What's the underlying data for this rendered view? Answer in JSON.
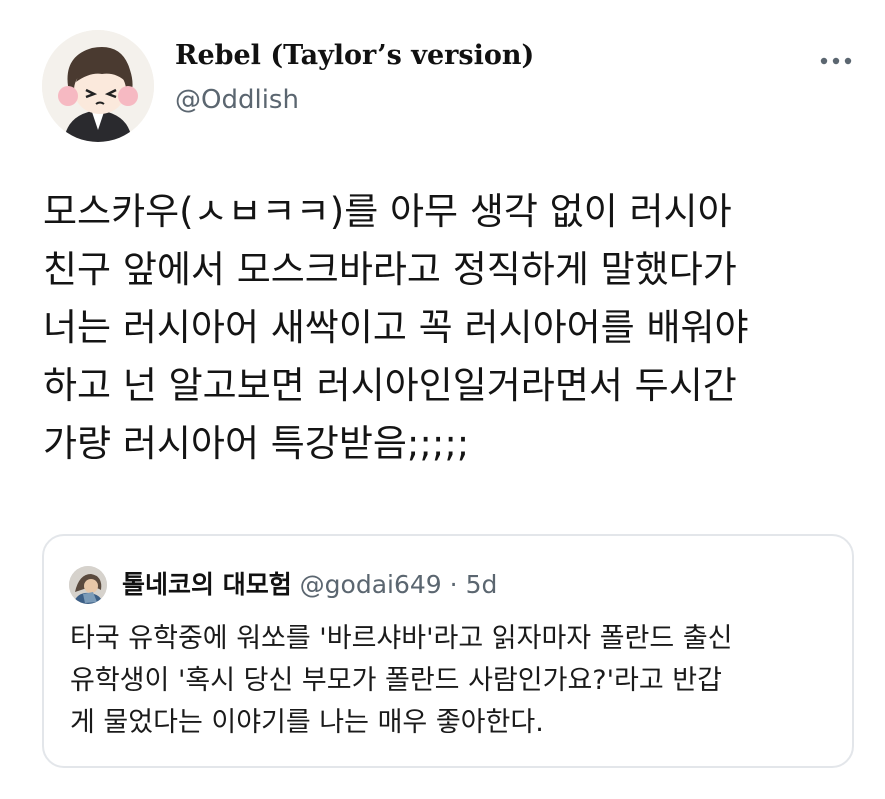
{
  "author": {
    "display_name": "Rebel (Taylor’s version)",
    "handle": "@Oddlish",
    "avatar_icon": "cartoon-avatar-icon"
  },
  "menu_icon": "more-dots-icon",
  "tweet": {
    "lines": [
      "모스카우(ㅅㅂㅋㅋ)를 아무 생각 없이 러시아",
      "친구 앞에서 모스크바라고 정직하게 말했다가",
      "너는 러시아어 새싹이고 꼭 러시아어를 배워야",
      "하고 넌 알고보면 러시아인일거라면서 두시간",
      "가량 러시아어 특강받음;;;;;"
    ]
  },
  "quote": {
    "avatar_icon": "quote-avatar-icon",
    "name": "톨네코의 대모험",
    "handle": "@godai649",
    "separator": "·",
    "time": "5d",
    "lines": [
      "타국 유학중에 워쏘를 '바르샤바'라고 읽자마자 폴란드 출신",
      "유학생이 '혹시 당신 부모가 폴란드 사람인가요?'라고 반갑",
      "게 물었다는 이야기를 나는 매우 좋아한다."
    ]
  },
  "colors": {
    "text": "#141414",
    "secondary_text": "#5b6670",
    "card_border": "#e3e6ea",
    "background": "#ffffff"
  }
}
